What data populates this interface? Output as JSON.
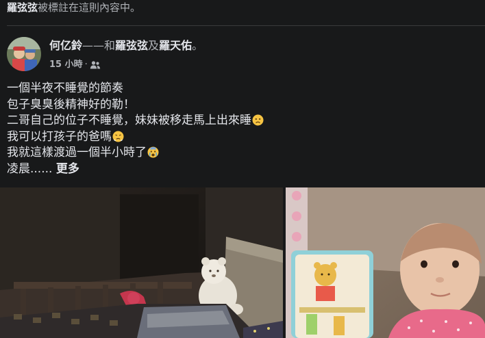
{
  "tag_notice": {
    "tagged_name": "羅弦弦",
    "suffix": "被標註在這則內容中。"
  },
  "post": {
    "author": "何亿鈴",
    "connector_1": "——和",
    "tagged_1": "羅弦弦",
    "connector_2": "及",
    "tagged_2": "羅天佑",
    "end_mark": "。",
    "time": "15 小時",
    "separator": "·",
    "audience_icon": "friends-icon",
    "lines": [
      "一個半夜不睡覺的節奏",
      "包子臭臭後精神好的勒！",
      "二哥自己的位子不睡覺，妹妹被移走馬上出來睡",
      "我可以打孩子的爸嗎",
      "我就這樣渡過一個半小時了",
      "凌晨......"
    ],
    "more_label": "更多",
    "emojis": [
      "disappointed-face-emoji",
      "pouting-face-emoji",
      "crying-face-emoji"
    ]
  },
  "photos": [
    {
      "icon": "crib-night-photo"
    },
    {
      "icon": "baby-photo"
    }
  ],
  "colors": {
    "background": "#18191a",
    "primary_text": "#e4e6eb",
    "secondary_text": "#b0b3b8",
    "divider": "#3a3b3c"
  }
}
